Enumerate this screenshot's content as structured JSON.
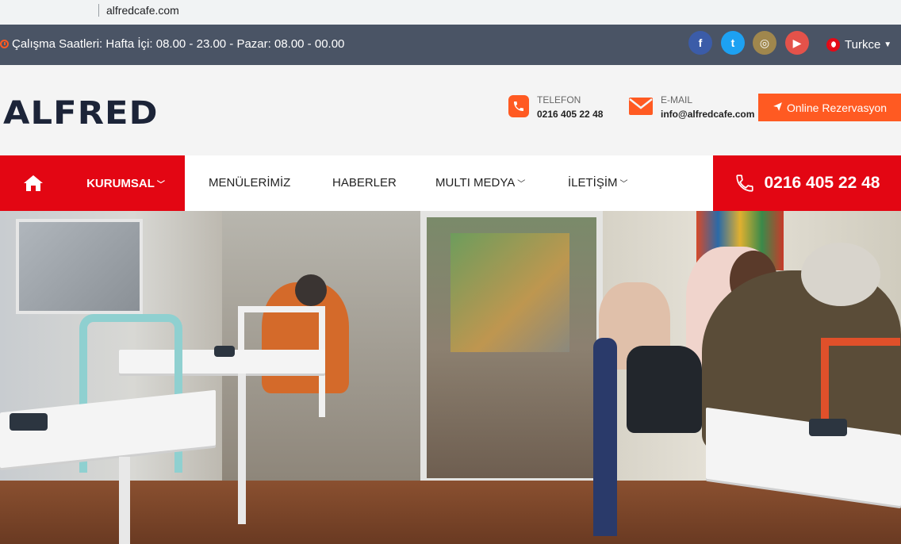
{
  "browser": {
    "url": "alfredcafe.com"
  },
  "topbar": {
    "hours": "Çalışma Saatleri: Hafta İçi: 08.00 - 23.00 - Pazar: 08.00 - 00.00",
    "social": [
      {
        "icon": "facebook-icon",
        "glyph": "f"
      },
      {
        "icon": "twitter-icon",
        "glyph": "t"
      },
      {
        "icon": "instagram-icon",
        "glyph": "◎"
      },
      {
        "icon": "youtube-icon",
        "glyph": "▶"
      }
    ],
    "language": "Turkce"
  },
  "header": {
    "logo": "ALFRED",
    "phone_label": "TELEFON",
    "phone_value": "0216 405 22 48",
    "email_label": "E-MAIL",
    "email_value": "info@alfredcafe.com",
    "reservation_button": "Online Rezervasyon"
  },
  "nav": {
    "items": [
      {
        "label": "KURUMSAL",
        "dropdown": true
      },
      {
        "label": "MENÜLERİMİZ",
        "dropdown": false
      },
      {
        "label": "HABERLER",
        "dropdown": false
      },
      {
        "label": "MULTI MEDYA",
        "dropdown": true
      },
      {
        "label": "İLETİŞİM",
        "dropdown": true
      }
    ],
    "phone": "0216 405 22 48"
  },
  "colors": {
    "topbar": "#4a5465",
    "accent_orange": "#ff5a22",
    "nav_red": "#e30613",
    "logo_navy": "#1c2438"
  }
}
